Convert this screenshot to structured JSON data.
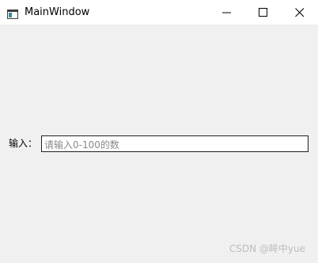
{
  "window": {
    "title": "MainWindow",
    "app_icon": "window-app-icon",
    "controls": {
      "minimize_icon": "minimize-icon",
      "maximize_icon": "maximize-icon",
      "close_icon": "close-icon"
    }
  },
  "form": {
    "label": "输入：",
    "input_value": "",
    "input_placeholder": "请输入0-100的数"
  },
  "watermark": "CSDN @眸中yue",
  "colors": {
    "titlebar": "#ffffff",
    "client_background": "#f0f0f0",
    "input_border": "#1f1f1f",
    "placeholder": "#8a8a8a"
  }
}
